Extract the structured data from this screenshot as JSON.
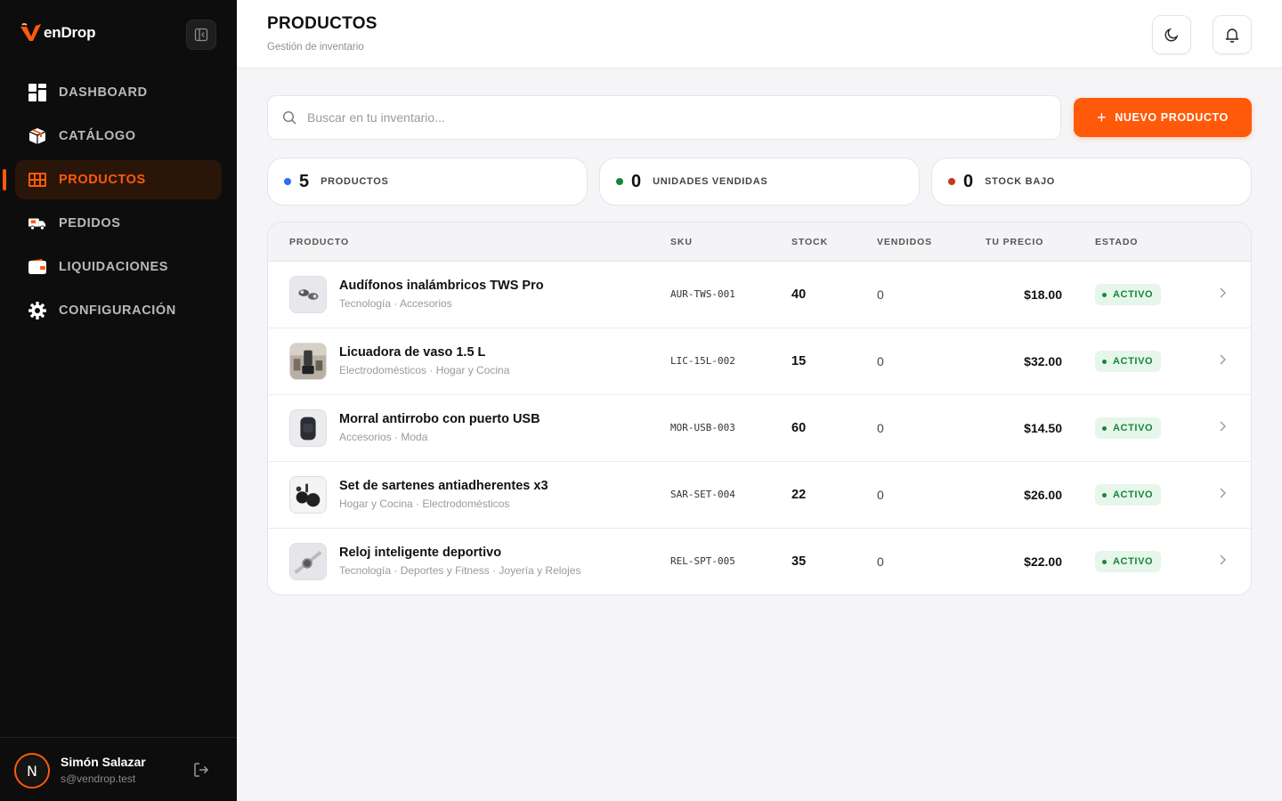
{
  "brand": {
    "name": "enDrop",
    "accent": "#ff5a0a"
  },
  "sidebar": {
    "collapse_icon": "sidebar-collapse-icon",
    "items": [
      {
        "label": "DASHBOARD",
        "icon": "dashboard-icon",
        "active": false
      },
      {
        "label": "CATÁLOGO",
        "icon": "box-icon",
        "active": false
      },
      {
        "label": "PRODUCTOS",
        "icon": "products-grid-icon",
        "active": true
      },
      {
        "label": "PEDIDOS",
        "icon": "truck-icon",
        "active": false
      },
      {
        "label": "LIQUIDACIONES",
        "icon": "wallet-icon",
        "active": false
      },
      {
        "label": "CONFIGURACIÓN",
        "icon": "gear-icon",
        "active": false
      }
    ],
    "user": {
      "initial": "N",
      "name": "Simón Salazar",
      "email": "s@vendrop.test"
    }
  },
  "header": {
    "title": "PRODUCTOS",
    "subtitle": "Gestión de inventario",
    "theme_icon": "moon-icon",
    "notif_icon": "bell-icon"
  },
  "search": {
    "placeholder": "Buscar en tu inventario..."
  },
  "new_button": {
    "label": "NUEVO PRODUCTO"
  },
  "stats": [
    {
      "value": "5",
      "label": "PRODUCTOS",
      "color": "#2b6ef2"
    },
    {
      "value": "0",
      "label": "UNIDADES VENDIDAS",
      "color": "#18853a"
    },
    {
      "value": "0",
      "label": "STOCK BAJO",
      "color": "#c0391b"
    }
  ],
  "table": {
    "headers": {
      "product": "PRODUCTO",
      "sku": "SKU",
      "stock": "STOCK",
      "sold": "VENDIDOS",
      "price": "TU PRECIO",
      "status": "ESTADO"
    },
    "rows": [
      {
        "name": "Audífonos inalámbricos TWS Pro",
        "categories": "Tecnología · Accesorios",
        "sku": "AUR-TWS-001",
        "stock": "40",
        "sold": "0",
        "price": "$18.00",
        "status": "ACTIVO"
      },
      {
        "name": "Licuadora de vaso 1.5 L",
        "categories": "Electrodomésticos · Hogar y Cocina",
        "sku": "LIC-15L-002",
        "stock": "15",
        "sold": "0",
        "price": "$32.00",
        "status": "ACTIVO"
      },
      {
        "name": "Morral antirrobo con puerto USB",
        "categories": "Accesorios · Moda",
        "sku": "MOR-USB-003",
        "stock": "60",
        "sold": "0",
        "price": "$14.50",
        "status": "ACTIVO"
      },
      {
        "name": "Set de sartenes antiadherentes x3",
        "categories": "Hogar y Cocina · Electrodomésticos",
        "sku": "SAR-SET-004",
        "stock": "22",
        "sold": "0",
        "price": "$26.00",
        "status": "ACTIVO"
      },
      {
        "name": "Reloj inteligente deportivo",
        "categories": "Tecnología · Deportes y Fitness · Joyería y Relojes",
        "sku": "REL-SPT-005",
        "stock": "35",
        "sold": "0",
        "price": "$22.00",
        "status": "ACTIVO"
      }
    ]
  }
}
